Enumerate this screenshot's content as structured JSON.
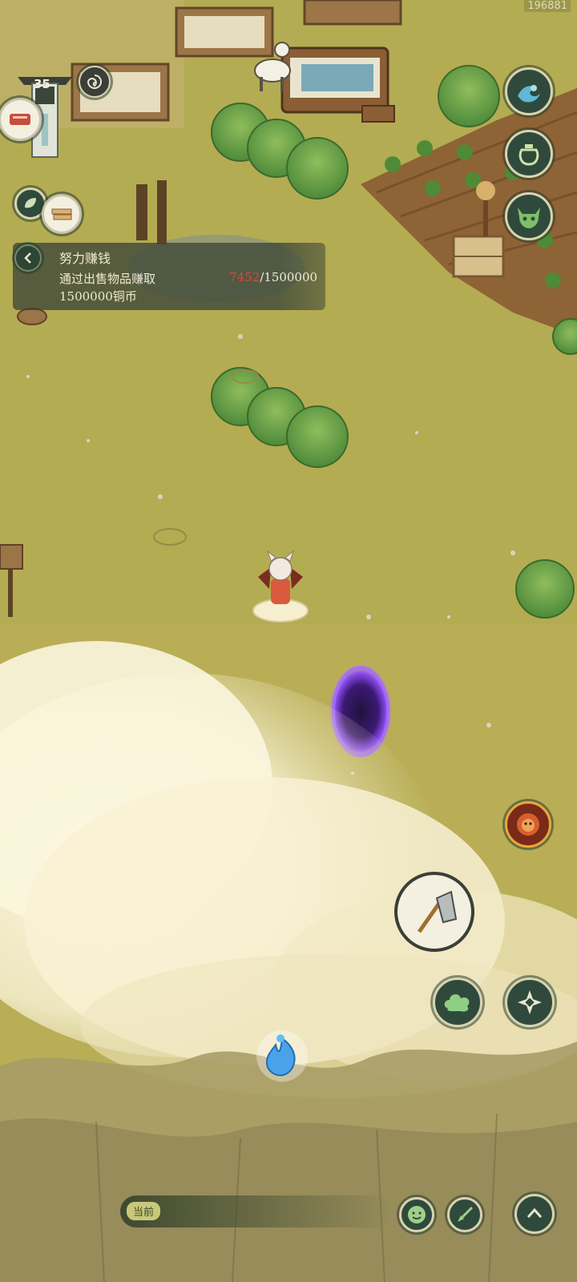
{
  "hud": {
    "player_id": "196881",
    "level": "35"
  },
  "quest": {
    "title": "努力赚钱",
    "description": "通过出售物品赚取",
    "progress_current": "7452",
    "progress_total": "/1500000",
    "reward": "1500000铜币"
  },
  "chat": {
    "channel_label": "当前"
  },
  "buttons": {
    "top_right": [
      "wave-icon",
      "pot-icon",
      "demon-mask-icon"
    ],
    "bottom_right": [
      "lion-icon",
      "hoe-icon",
      "cloud-icon",
      "shuriken-icon"
    ],
    "bottom_bar": [
      "emoji-icon",
      "brush-icon",
      "expand-up-icon"
    ]
  },
  "colors": {
    "grass": "#b7ad55",
    "button_fill": "#2f4a3c",
    "button_ring": "#d9d4b0",
    "quest_progress_current": "#d94a3e",
    "portal": "#7c3fe0"
  }
}
